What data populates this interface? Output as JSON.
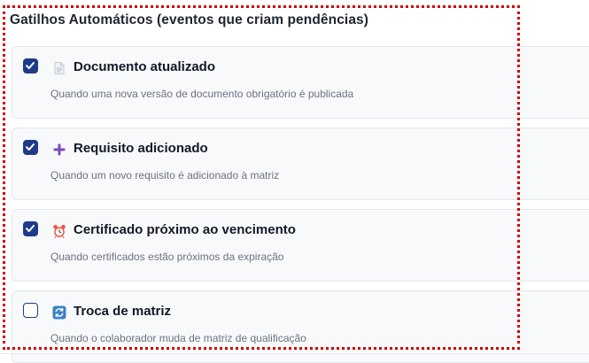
{
  "section": {
    "title": "Gatilhos Automáticos (eventos que criam pendências)"
  },
  "triggers": [
    {
      "title": "Documento atualizado",
      "description": "Quando uma nova versão de documento obrigatório é publicada",
      "checked": true,
      "icon": "document-icon"
    },
    {
      "title": "Requisito adicionado",
      "description": "Quando um novo requisito é adicionado à matriz",
      "checked": true,
      "icon": "plus-icon"
    },
    {
      "title": "Certificado próximo ao vencimento",
      "description": "Quando certificados estão próximos da expiração",
      "checked": true,
      "icon": "alarm-clock-icon"
    },
    {
      "title": "Troca de matriz",
      "description": "Quando o colaborador muda de matriz de qualificação",
      "checked": false,
      "icon": "refresh-icon"
    }
  ],
  "colors": {
    "checkbox_accent": "#1e3a8a",
    "highlight_outline": "#d40000",
    "plus_icon": "#7c4dbd",
    "alarm_icon": "#e85a4f",
    "refresh_icon": "#3b82c4"
  }
}
